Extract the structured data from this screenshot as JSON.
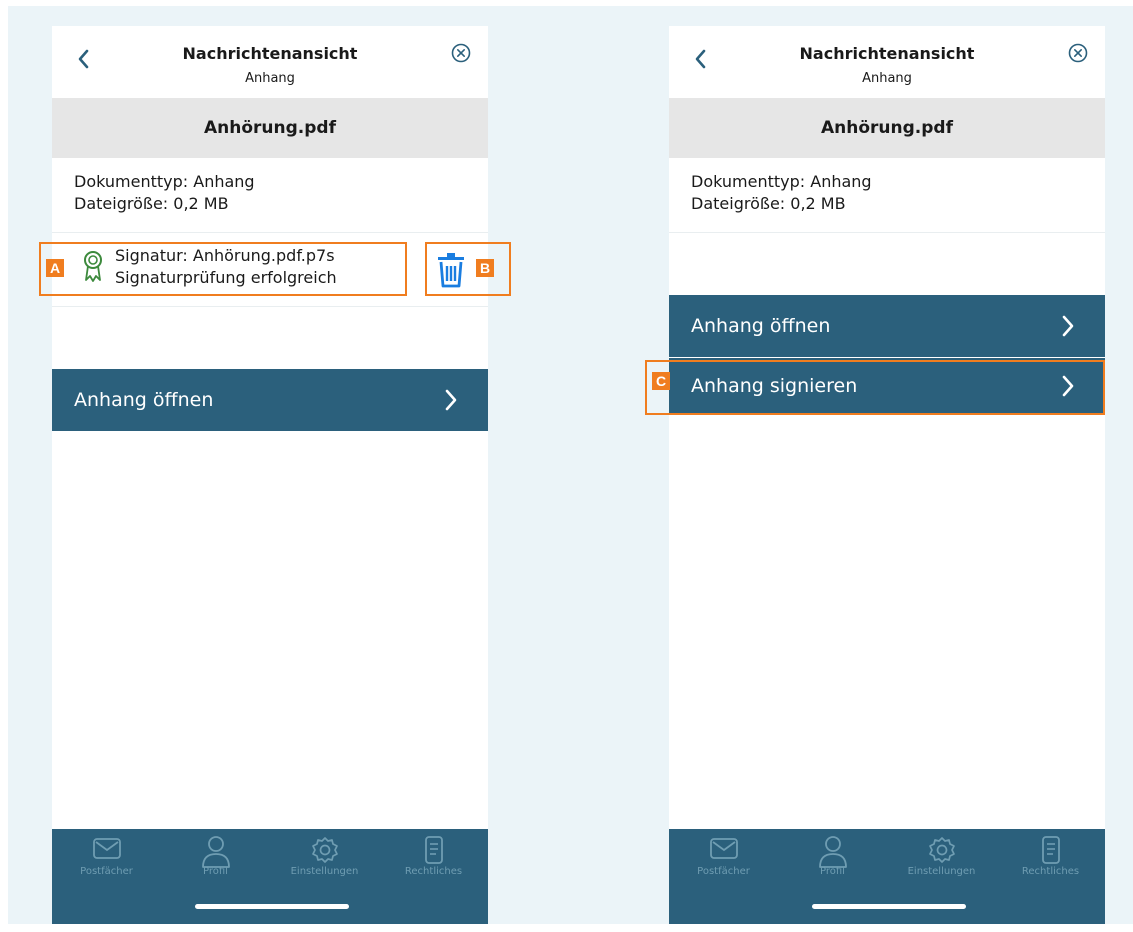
{
  "screens": {
    "left": {
      "title": "Nachrichtenansicht",
      "subtitle": "Anhang",
      "filename": "Anhörung.pdf",
      "doc_type": "Dokumenttyp: Anhang",
      "file_size": "Dateigröße: 0,2 MB",
      "signature_name": "Signatur: Anhörung.pdf.p7s",
      "signature_status": "Signaturprüfung erfolgreich",
      "open_label": "Anhang öffnen"
    },
    "right": {
      "title": "Nachrichtenansicht",
      "subtitle": "Anhang",
      "filename": "Anhörung.pdf",
      "doc_type": "Dokumenttyp: Anhang",
      "file_size": "Dateigröße: 0,2 MB",
      "open_label": "Anhang öffnen",
      "sign_label": "Anhang signieren"
    }
  },
  "tabbar": {
    "items": [
      {
        "label": "Postfächer",
        "icon": "mail-icon"
      },
      {
        "label": "Profil",
        "icon": "profile-icon"
      },
      {
        "label": "Einstellungen",
        "icon": "gear-icon"
      },
      {
        "label": "Rechtliches",
        "icon": "document-icon"
      }
    ]
  },
  "callouts": {
    "a": "A",
    "b": "B",
    "c": "C"
  },
  "colors": {
    "primary": "#2b607c",
    "highlight": "#f07d1f",
    "signature_icon": "#3d8a3d",
    "delete_icon": "#1a7de0",
    "filename_bar": "#e6e6e6",
    "background": "#ebf4f8"
  }
}
